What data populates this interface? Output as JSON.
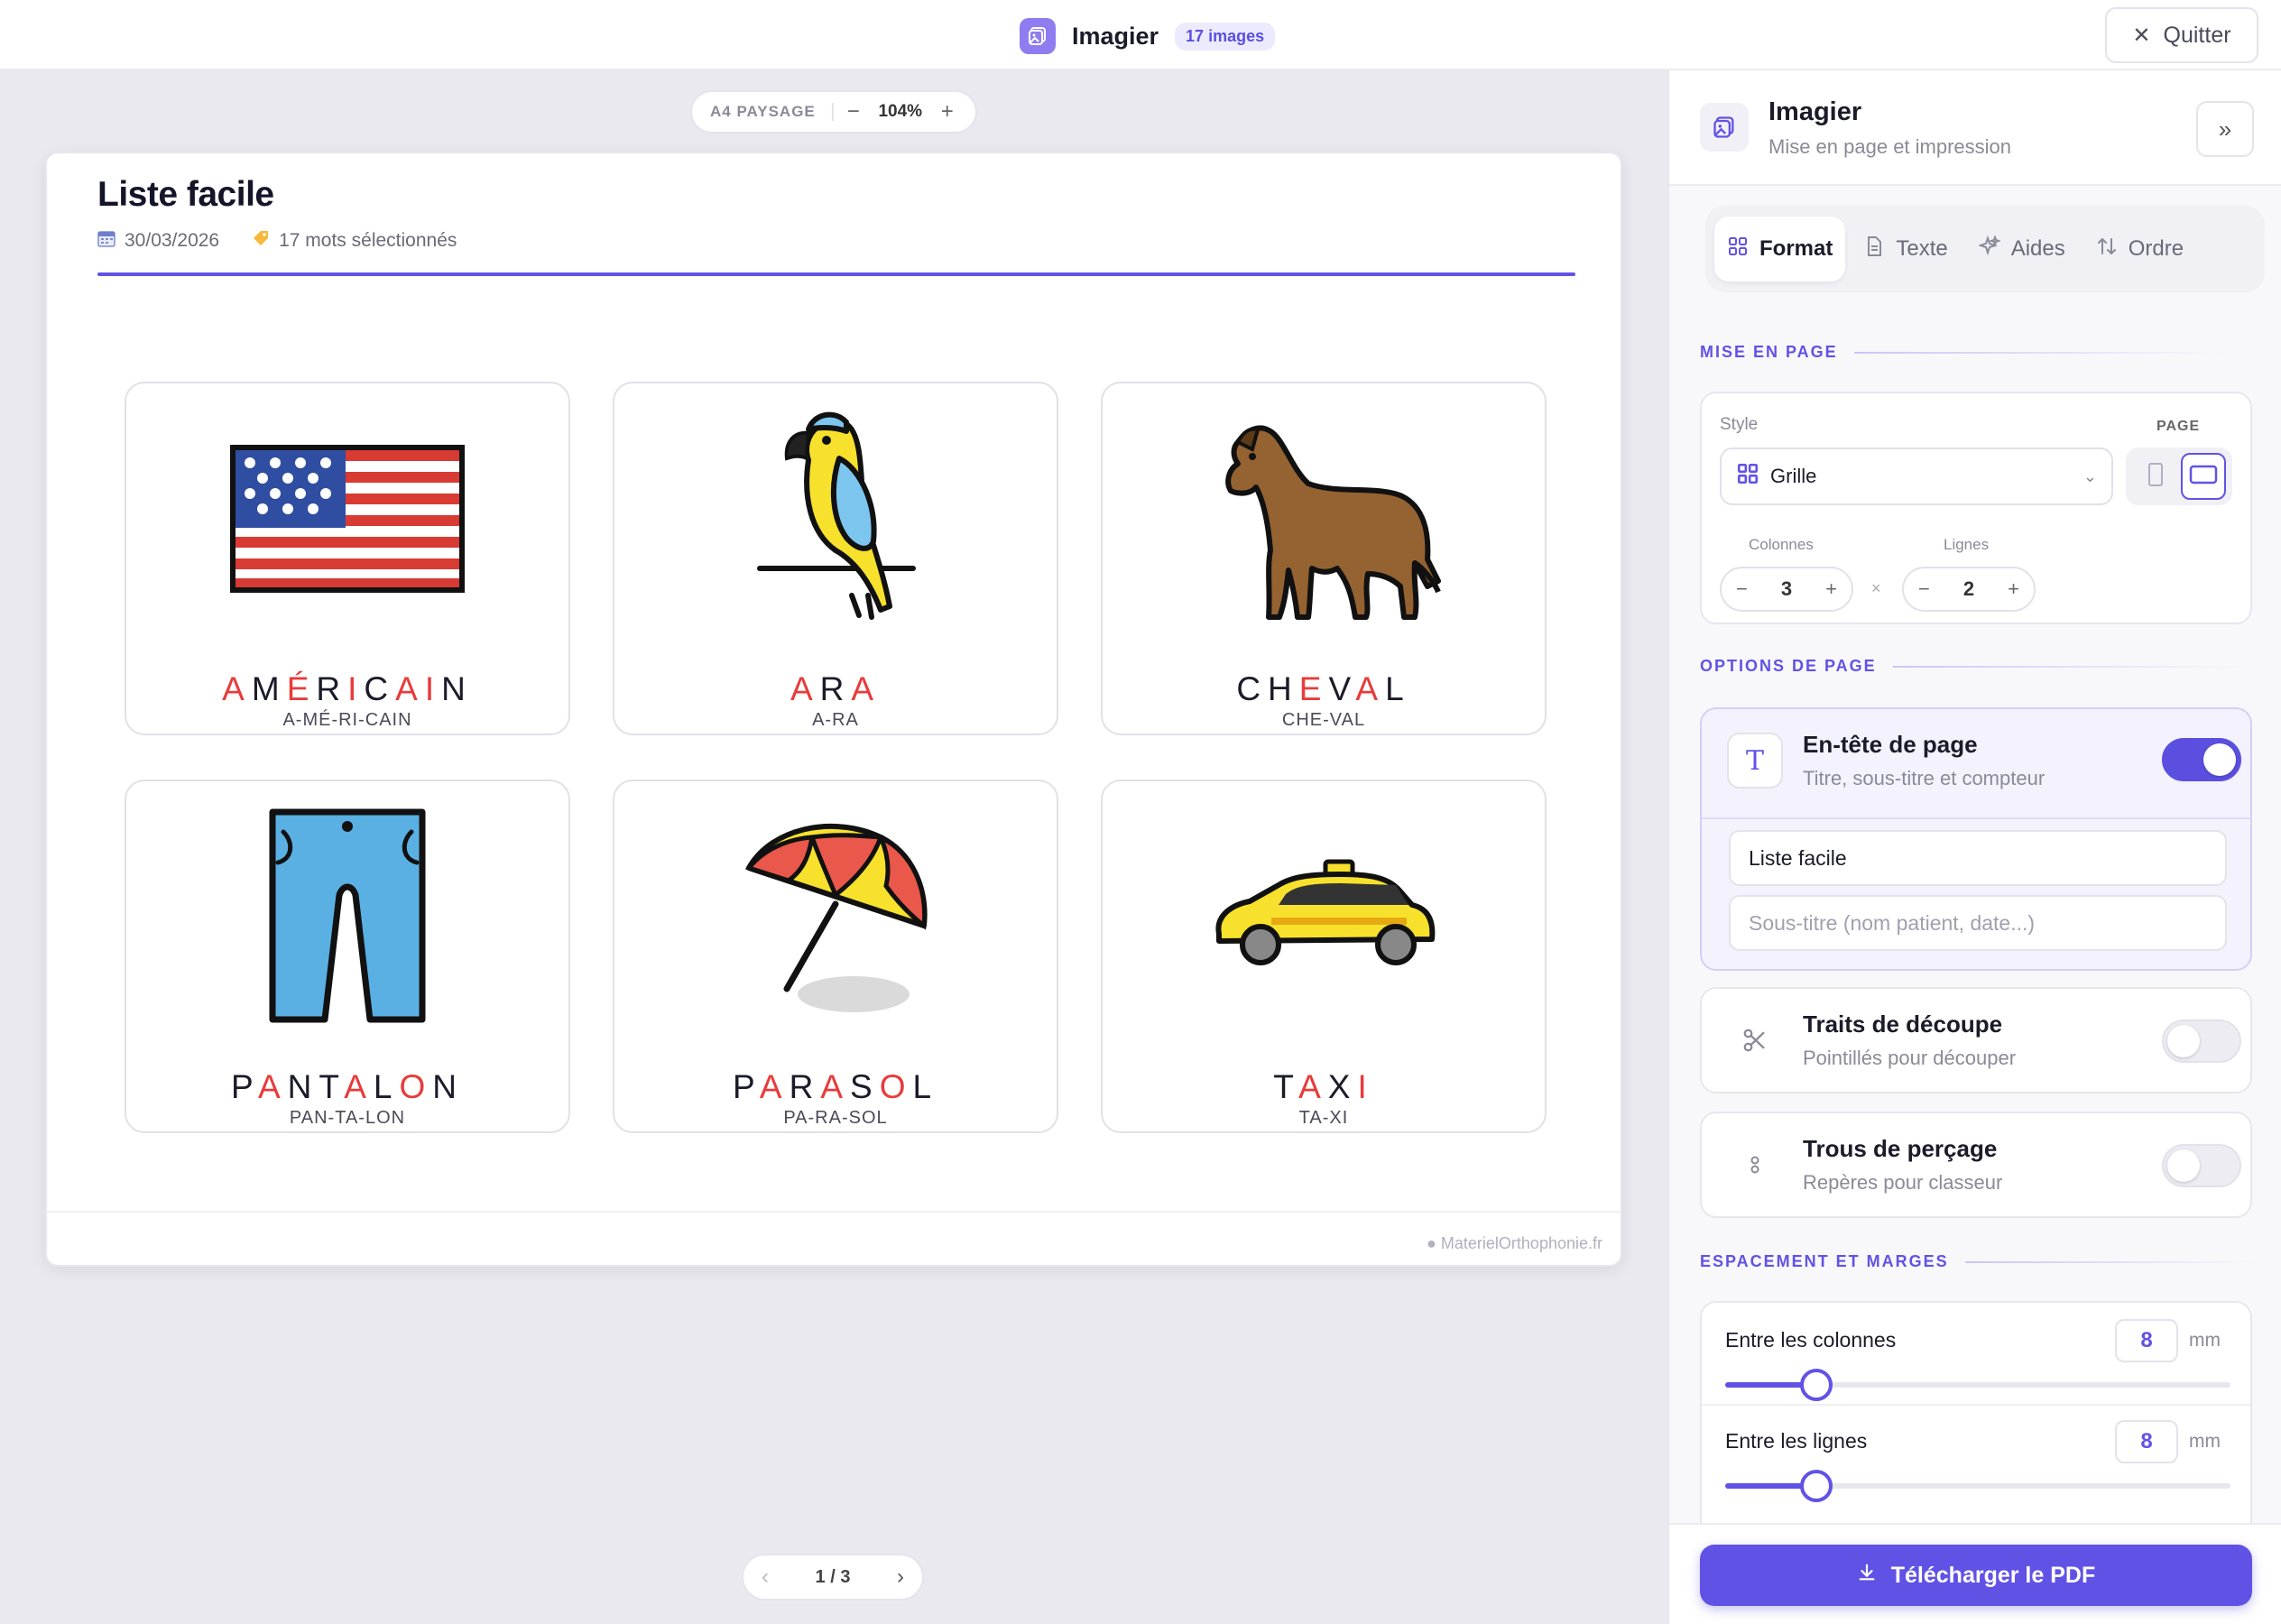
{
  "topbar": {
    "title": "Imagier",
    "badge": "17 images",
    "quit_label": "Quitter"
  },
  "zoom": {
    "format": "A4 PAYSAGE",
    "minus": "−",
    "value": "104%",
    "plus": "+"
  },
  "paper": {
    "title": "Liste facile",
    "date": "30/03/2026",
    "selected": "17 mots sélectionnés",
    "footer": "● MaterielOrthophonie.fr"
  },
  "cards": [
    {
      "letters": [
        "A",
        "M",
        "É",
        "R",
        "I",
        "C",
        "A",
        "I",
        "N"
      ],
      "red": [
        0,
        2,
        4,
        6,
        7
      ],
      "syll": "A-MÉ-RI-CAIN",
      "icon": "us-flag-icon"
    },
    {
      "letters": [
        "A",
        "R",
        "A"
      ],
      "red": [
        0,
        2
      ],
      "syll": "A-RA",
      "icon": "parrot-icon"
    },
    {
      "letters": [
        "C",
        "H",
        "E",
        "V",
        "A",
        "L"
      ],
      "red": [
        2,
        4
      ],
      "syll": "CHE-VAL",
      "icon": "horse-icon"
    },
    {
      "letters": [
        "P",
        "A",
        "N",
        "T",
        "A",
        "L",
        "O",
        "N"
      ],
      "red": [
        1,
        4,
        6
      ],
      "syll": "PAN-TA-LON",
      "icon": "trousers-icon"
    },
    {
      "letters": [
        "P",
        "A",
        "R",
        "A",
        "S",
        "O",
        "L"
      ],
      "red": [
        1,
        3,
        5
      ],
      "syll": "PA-RA-SOL",
      "icon": "parasol-icon"
    },
    {
      "letters": [
        "T",
        "A",
        "X",
        "I"
      ],
      "red": [
        1,
        3
      ],
      "syll": "TA-XI",
      "icon": "taxi-icon"
    }
  ],
  "pager": {
    "prev": "‹",
    "current": "1 / 3",
    "next": "›"
  },
  "panel": {
    "title": "Imagier",
    "subtitle": "Mise en page et impression",
    "collapse": "»",
    "tabs": [
      {
        "label": "Format",
        "icon": "grid-icon",
        "active": true
      },
      {
        "label": "Texte",
        "icon": "document-icon",
        "active": false
      },
      {
        "label": "Aides",
        "icon": "sparkle-icon",
        "active": false
      },
      {
        "label": "Ordre",
        "icon": "sort-icon",
        "active": false
      }
    ],
    "layout": {
      "section": "MISE EN PAGE",
      "style_label": "Style",
      "style_value": "Grille",
      "page_label": "PAGE",
      "columns_label": "Colonnes",
      "columns_value": "3",
      "rows_label": "Lignes",
      "rows_value": "2",
      "times": "×",
      "minus": "−",
      "plus": "+"
    },
    "options": {
      "section": "OPTIONS DE PAGE",
      "header": {
        "title": "En-tête de page",
        "sub": "Titre, sous-titre et compteur",
        "on": true,
        "title_value": "Liste facile",
        "subtitle_placeholder": "Sous-titre (nom patient, date...)"
      },
      "cut": {
        "title": "Traits de découpe",
        "sub": "Pointillés pour découper",
        "on": false
      },
      "holes": {
        "title": "Trous de perçage",
        "sub": "Repères pour classeur",
        "on": false
      }
    },
    "spacing": {
      "section": "ESPACEMENT ET MARGES",
      "columns_label": "Entre les colonnes",
      "columns_value": "8",
      "columns_fraction": 0.18,
      "rows_label": "Entre les lignes",
      "rows_value": "8",
      "rows_fraction": 0.18,
      "unit": "mm"
    },
    "download_label": "Télécharger le PDF"
  },
  "colors": {
    "accent": "#6152e6",
    "red_letter": "#e83b3b"
  }
}
